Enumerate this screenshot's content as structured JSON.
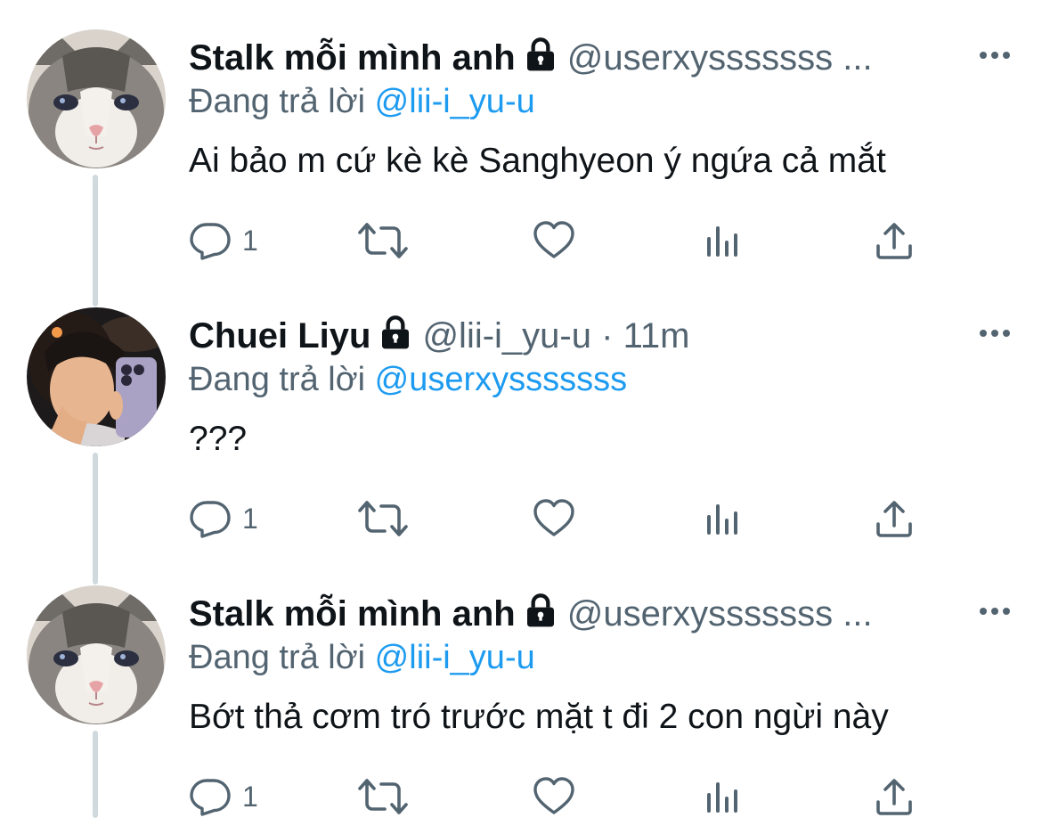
{
  "colors": {
    "text_primary": "#0f1419",
    "text_secondary": "#536471",
    "link": "#1d9bf0",
    "thread_line": "#cfd9de",
    "background": "#ffffff"
  },
  "reply_prefix": "Đang trả lời",
  "tweets": [
    {
      "avatar": "cat-avatar",
      "display_name": "Stalk mỗi mình anh",
      "locked": true,
      "handle": "@userxysssssss ...",
      "separator": "",
      "time": "",
      "replying_to": "@lii-i_yu-u",
      "text": "Ai bảo m cứ kè kè Sanghyeon ý ngứa cả mắt",
      "reply_count": "1",
      "retweet_count": "",
      "like_count": "",
      "icons": [
        "reply-icon",
        "retweet-icon",
        "like-icon",
        "views-icon",
        "share-icon",
        "more-icon",
        "lock-icon"
      ]
    },
    {
      "avatar": "person-avatar",
      "display_name": "Chuei Liyu",
      "locked": true,
      "handle": "@lii-i_yu-u",
      "separator": "·",
      "time": "11m",
      "replying_to": "@userxysssssss",
      "text": "???",
      "reply_count": "1",
      "retweet_count": "",
      "like_count": "",
      "icons": [
        "reply-icon",
        "retweet-icon",
        "like-icon",
        "views-icon",
        "share-icon",
        "more-icon",
        "lock-icon"
      ]
    },
    {
      "avatar": "cat-avatar",
      "display_name": "Stalk mỗi mình anh",
      "locked": true,
      "handle": "@userxysssssss ...",
      "separator": "",
      "time": "",
      "replying_to": "@lii-i_yu-u",
      "text": "Bớt thả cơm tró trước mặt t đi 2 con ngừi này",
      "reply_count": "1",
      "retweet_count": "",
      "like_count": "",
      "icons": [
        "reply-icon",
        "retweet-icon",
        "like-icon",
        "views-icon",
        "share-icon",
        "more-icon",
        "lock-icon"
      ]
    }
  ]
}
